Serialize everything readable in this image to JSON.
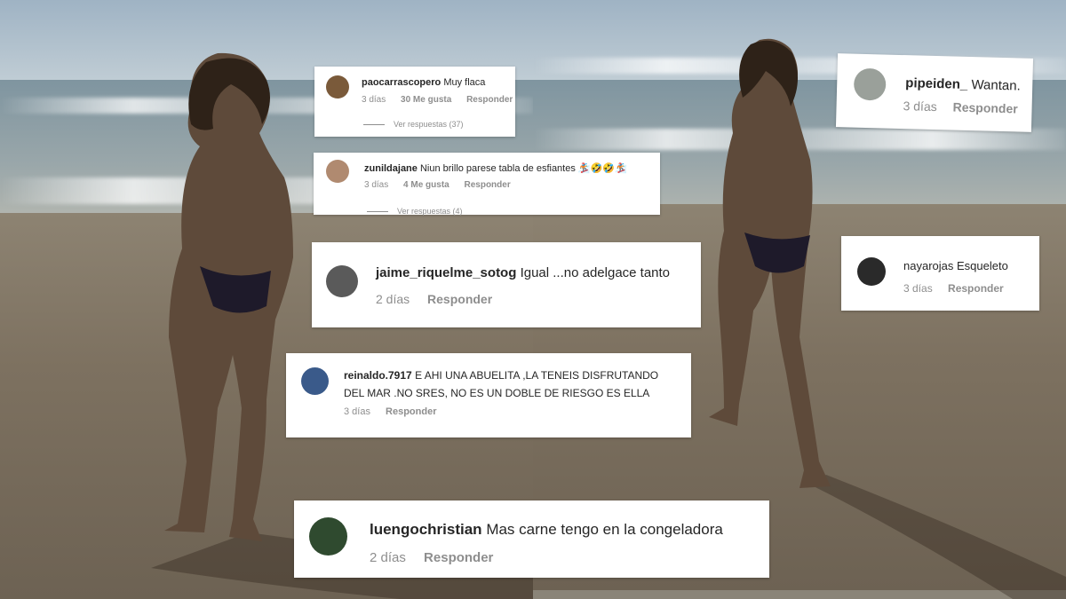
{
  "comments": [
    {
      "id": "c1",
      "user": "paocarrascopero",
      "text": "Muy flaca",
      "time": "3 días",
      "likes": "30 Me gusta",
      "reply": "Responder",
      "view_replies": "Ver respuestas (37)",
      "avatar_color": "#7a5a3a"
    },
    {
      "id": "c2",
      "user": "zunildajane",
      "text": "Niun brillo parese tabla de esfiantes 🏂🤣🤣🏂",
      "time": "3 días",
      "likes": "4 Me gusta",
      "reply": "Responder",
      "view_replies": "Ver respuestas (4)",
      "avatar_color": "#b08a70"
    },
    {
      "id": "c3",
      "user": "jaime_riquelme_sotog",
      "text": "Igual ...no adelgace tanto",
      "time": "2 días",
      "reply": "Responder",
      "avatar_color": "#5a5a5a"
    },
    {
      "id": "c4",
      "user": "reinaldo.7917",
      "text_line1": "E AHI UNA ABUELITA ,LA TENEIS DISFRUTANDO",
      "text_line2": "DEL MAR .NO SRES, NO ES UN DOBLE DE RIESGO ES ELLA",
      "time": "3 días",
      "reply": "Responder",
      "avatar_color": "#3a5a8a"
    },
    {
      "id": "c5",
      "user": "luengochristian",
      "text": "Mas carne tengo en la congeladora",
      "time": "2 días",
      "reply": "Responder",
      "avatar_color": "#2f4a2f"
    },
    {
      "id": "c6",
      "user": "pipeiden_",
      "text": "Wantan.",
      "time": "3 días",
      "reply": "Responder",
      "avatar_color": "#9aa09a"
    },
    {
      "id": "c7",
      "user": "nayarojas",
      "text": "Esqueleto",
      "time": "3 días",
      "reply": "Responder",
      "avatar_color": "#2a2a2a"
    }
  ]
}
